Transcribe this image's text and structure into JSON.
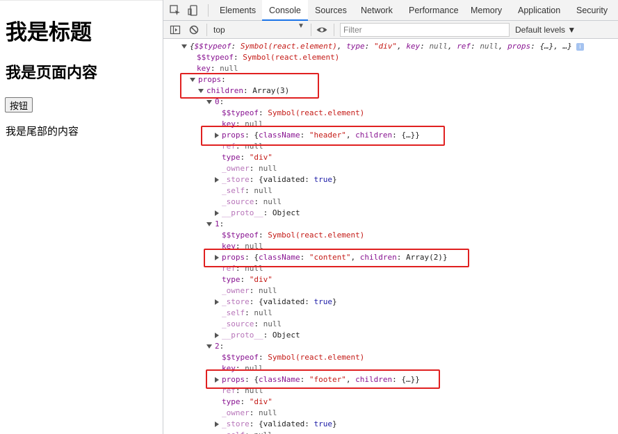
{
  "page": {
    "title": "我是标题",
    "subtitle": "我是页面内容",
    "button": "按钮",
    "footer": "我是尾部的内容"
  },
  "devtools": {
    "tabs": [
      "Elements",
      "Console",
      "Sources",
      "Network",
      "Performance",
      "Memory",
      "Application",
      "Security"
    ],
    "active_tab": "Console",
    "context": "top",
    "filter_placeholder": "Filter",
    "levels": "Default levels ▼"
  },
  "console": {
    "summary_keys": [
      "$$typeof",
      "type",
      "key",
      "ref",
      "props"
    ],
    "summary_vals": [
      "Symbol(react.element)",
      "\"div\"",
      "null",
      "null",
      "{…}",
      "…"
    ],
    "lines": {
      "typeof_key": "$$typeof",
      "typeof_val": "Symbol(react.element)",
      "key_key": "key",
      "null": "null",
      "props_key": "props",
      "children_key": "children",
      "children_val": "Array(3)",
      "idx0": "0",
      "idx1": "1",
      "idx2": "2",
      "ref_key": "ref",
      "type_key": "type",
      "div": "\"div\"",
      "owner_key": "_owner",
      "store_key": "_store",
      "store_val_prefix": "{validated: ",
      "true": "true",
      "store_val_suffix": "}",
      "self_key": "_self",
      "source_key": "_source",
      "proto_key": "__proto__",
      "proto_val": "Object",
      "classname_key": "className",
      "header_val": "\"header\"",
      "content_val": "\"content\"",
      "footer_val": "\"footer\"",
      "children_obj": "{…}",
      "children_arr2": "Array(2)"
    }
  },
  "colors": {
    "highlight": "#e02020",
    "accent": "#1a73e8"
  }
}
